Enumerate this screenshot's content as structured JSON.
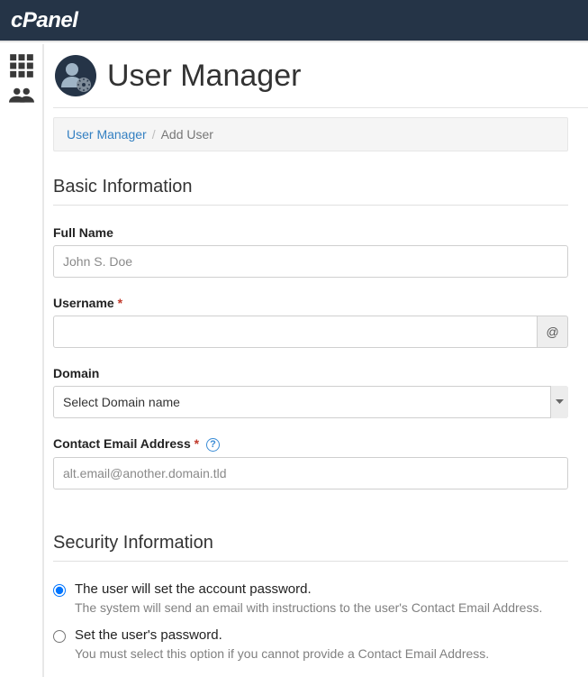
{
  "brand": "cPanel",
  "page_title": "User Manager",
  "breadcrumb": {
    "root": "User Manager",
    "sep": "/",
    "current": "Add User"
  },
  "sections": {
    "basic": {
      "title": "Basic Information",
      "full_name": {
        "label": "Full Name",
        "placeholder": "John S. Doe",
        "value": ""
      },
      "username": {
        "label": "Username",
        "required": "*",
        "addon": "@",
        "value": ""
      },
      "domain": {
        "label": "Domain",
        "placeholder": "Select Domain name"
      },
      "email": {
        "label": "Contact Email Address",
        "required": "*",
        "help": "?",
        "placeholder": "alt.email@another.domain.tld",
        "value": ""
      }
    },
    "security": {
      "title": "Security Information",
      "opt1": {
        "label": "The user will set the account password.",
        "hint": "The system will send an email with instructions to the user's Contact Email Address."
      },
      "opt2": {
        "label": "Set the user's password.",
        "hint": "You must select this option if you cannot provide a Contact Email Address."
      }
    }
  },
  "icons": {
    "grid": "grid-icon",
    "users": "users-icon",
    "gear": "gear-icon"
  }
}
